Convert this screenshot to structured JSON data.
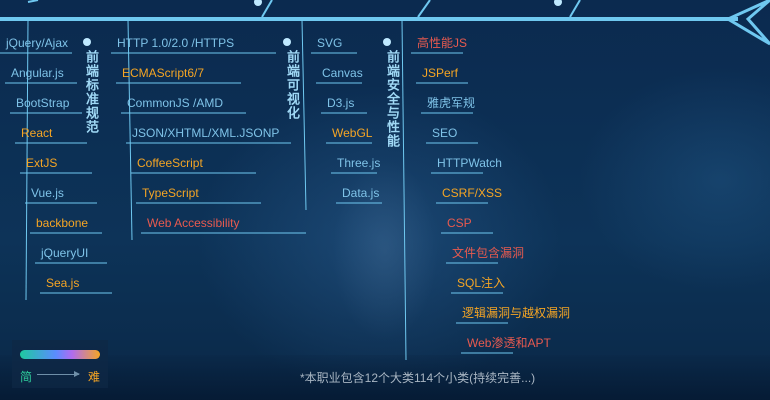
{
  "colors": {
    "spine": "#6fc8f0",
    "easy": "#7fc3e8",
    "medium": "#f5a524",
    "hard": "#e85a4f",
    "category": "#9fd8f5"
  },
  "columns": [
    {
      "category": "",
      "items": [
        {
          "label": "jQuery/Ajax",
          "level": "easy"
        },
        {
          "label": "Angular.js",
          "level": "easy"
        },
        {
          "label": "BootStrap",
          "level": "easy"
        },
        {
          "label": "React",
          "level": "medium"
        },
        {
          "label": "ExtJS",
          "level": "medium"
        },
        {
          "label": "Vue.js",
          "level": "easy"
        },
        {
          "label": "backbone",
          "level": "medium"
        },
        {
          "label": "jQueryUI",
          "level": "easy"
        },
        {
          "label": "Sea.js",
          "level": "medium"
        }
      ]
    },
    {
      "category": "前端标准规范",
      "items": [
        {
          "label": "HTTP 1.0/2.0 /HTTPS",
          "level": "easy"
        },
        {
          "label": "ECMAScript6/7",
          "level": "medium"
        },
        {
          "label": "CommonJS /AMD",
          "level": "easy"
        },
        {
          "label": "JSON/XHTML/XML.JSONP",
          "level": "easy"
        },
        {
          "label": "CoffeeScript",
          "level": "medium"
        },
        {
          "label": "TypeScript",
          "level": "medium"
        },
        {
          "label": "Web Accessibility",
          "level": "hard"
        }
      ]
    },
    {
      "category": "前端可视化",
      "items": [
        {
          "label": "SVG",
          "level": "easy"
        },
        {
          "label": "Canvas",
          "level": "easy"
        },
        {
          "label": "D3.js",
          "level": "easy"
        },
        {
          "label": "WebGL",
          "level": "medium"
        },
        {
          "label": "Three.js",
          "level": "easy"
        },
        {
          "label": "Data.js",
          "level": "easy"
        }
      ]
    },
    {
      "category": "前端安全与性能",
      "items": [
        {
          "label": "高性能JS",
          "level": "hard"
        },
        {
          "label": "JSPerf",
          "level": "medium"
        },
        {
          "label": "雅虎军规",
          "level": "easy"
        },
        {
          "label": "SEO",
          "level": "easy"
        },
        {
          "label": "HTTPWatch",
          "level": "easy"
        },
        {
          "label": "CSRF/XSS",
          "level": "medium"
        },
        {
          "label": "CSP",
          "level": "hard"
        },
        {
          "label": "文件包含漏洞",
          "level": "hard"
        },
        {
          "label": "SQL注入",
          "level": "medium"
        },
        {
          "label": "逻辑漏洞与越权漏洞",
          "level": "medium"
        },
        {
          "label": "Web渗透和APT",
          "level": "hard"
        }
      ]
    }
  ],
  "legend": {
    "easy_label": "简",
    "hard_label": "难"
  },
  "footnote": "*本职业包含12个大类114个小类(持续完善...)"
}
